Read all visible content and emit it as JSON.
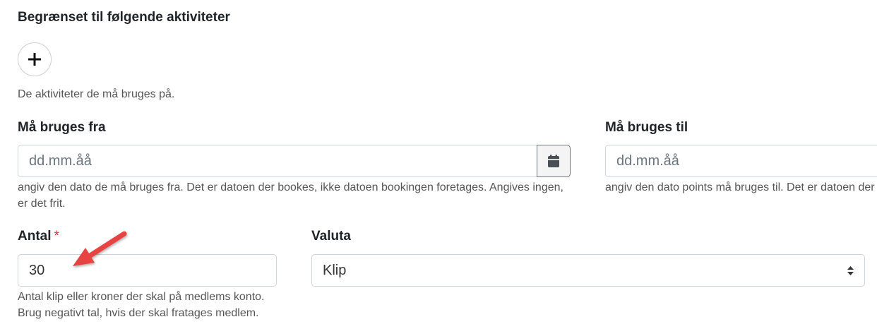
{
  "activities": {
    "heading": "Begrænset til følgende aktiviteter",
    "add_button_icon": "plus-icon",
    "help": "De aktiviteter de må bruges på."
  },
  "valid_from": {
    "label": "Må bruges fra",
    "placeholder": "dd.mm.åå",
    "calendar_icon": "calendar-icon",
    "help": "angiv den dato de må bruges fra. Det er datoen der bookes, ikke datoen bookingen foretages. Angives ingen, er det frit."
  },
  "valid_to": {
    "label": "Må bruges til",
    "placeholder": "dd.mm.åå",
    "help": "angiv den dato points må bruges til. Det er datoen der"
  },
  "amount": {
    "label": "Antal",
    "required_marker": "*",
    "value": "30",
    "help": "Antal klip eller kroner der skal på medlems konto. Brug negativt tal, hvis der skal fratages medlem."
  },
  "currency": {
    "label": "Valuta",
    "selected": "Klip",
    "caret_icon": "select-caret-icon"
  },
  "annotation": {
    "icon": "red-arrow-pointing-at-amount-input"
  },
  "colors": {
    "text": "#212529",
    "help_text": "#555555",
    "input_border": "#ced4da",
    "required": "#dc3545",
    "annotation_arrow": "#e84343"
  }
}
